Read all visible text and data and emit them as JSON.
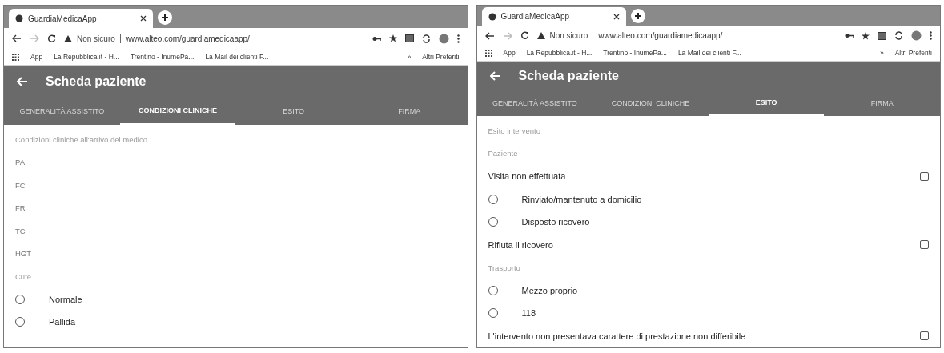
{
  "windows": [
    {
      "tab_title": "GuardiaMedicaApp",
      "security": "Non sicuro",
      "url": "www.alteo.com/guardiamedicaapp/",
      "bookmarks": [
        "App",
        "La Repubblica.it - H...",
        "Trentino - InumePa...",
        "La Mail dei clienti F..."
      ],
      "more_bookmarks": "»",
      "other_bookmarks": "Altri Preferiti",
      "app_title": "Scheda paziente",
      "tabs": [
        {
          "label": "GENERALITÀ ASSISTITO",
          "selected": false
        },
        {
          "label": "CONDIZIONI CLINICHE",
          "selected": true
        },
        {
          "label": "ESITO",
          "selected": false
        },
        {
          "label": "FIRMA",
          "selected": false
        }
      ],
      "items": [
        {
          "kind": "section",
          "label": "Condizioni cliniche all'arrivo del medico"
        },
        {
          "kind": "field",
          "placeholder": "PA"
        },
        {
          "kind": "field",
          "placeholder": "FC"
        },
        {
          "kind": "field",
          "placeholder": "FR"
        },
        {
          "kind": "field",
          "placeholder": "TC"
        },
        {
          "kind": "field",
          "placeholder": "HGT"
        },
        {
          "kind": "section",
          "label": "Cute"
        },
        {
          "kind": "radio",
          "label": "Normale",
          "selected": false
        },
        {
          "kind": "radio",
          "label": "Pallida",
          "selected": false
        }
      ]
    },
    {
      "tab_title": "GuardiaMedicaApp",
      "security": "Non sicuro",
      "url": "www.alteo.com/guardiamedicaapp/",
      "bookmarks": [
        "App",
        "La Repubblica.it - H...",
        "Trentino - InumePa...",
        "La Mail dei clienti F..."
      ],
      "more_bookmarks": "»",
      "other_bookmarks": "Altri Preferiti",
      "app_title": "Scheda paziente",
      "tabs": [
        {
          "label": "GENERALITÀ ASSISTITO",
          "selected": false
        },
        {
          "label": "CONDIZIONI CLINICHE",
          "selected": false
        },
        {
          "label": "ESITO",
          "selected": true
        },
        {
          "label": "FIRMA",
          "selected": false
        }
      ],
      "items": [
        {
          "kind": "section",
          "label": "Esito intervento"
        },
        {
          "kind": "section",
          "label": "Paziente"
        },
        {
          "kind": "checkbox",
          "label": "Visita non effettuata",
          "checked": false
        },
        {
          "kind": "radio",
          "label": "Rinviato/mantenuto a domicilio",
          "selected": false
        },
        {
          "kind": "radio",
          "label": "Disposto ricovero",
          "selected": false
        },
        {
          "kind": "checkbox",
          "label": "Rifiuta il ricovero",
          "checked": false
        },
        {
          "kind": "section",
          "label": "Trasporto"
        },
        {
          "kind": "radio",
          "label": "Mezzo proprio",
          "selected": false
        },
        {
          "kind": "radio",
          "label": "118",
          "selected": false
        },
        {
          "kind": "checkbox",
          "label": "L'intervento non presentava carattere di prestazione non differibile",
          "checked": false
        }
      ]
    }
  ]
}
